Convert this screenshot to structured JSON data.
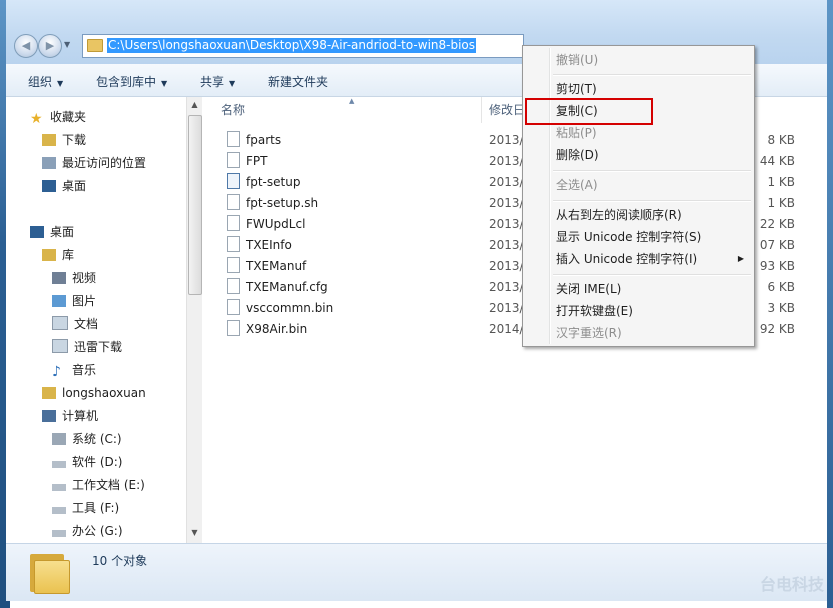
{
  "address": {
    "path": "C:\\Users\\longshaoxuan\\Desktop\\X98-Air-andriod-to-win8-bios"
  },
  "toolbar": {
    "organize": "组织",
    "include_in_library": "包含到库中",
    "share": "共享",
    "new_folder": "新建文件夹"
  },
  "nav": {
    "favorites": "收藏夹",
    "fav_items": [
      "下载",
      "最近访问的位置",
      "桌面"
    ],
    "desktop": "桌面",
    "library": "库",
    "lib_items": [
      "视频",
      "图片",
      "文档",
      "迅雷下载",
      "音乐"
    ],
    "user": "longshaoxuan",
    "computer": "计算机",
    "drives": [
      "系统 (C:)",
      "软件 (D:)",
      "工作文档 (E:)",
      "工具 (F:)",
      "办公 (G:)"
    ]
  },
  "columns": {
    "name": "名称",
    "date": "修改日"
  },
  "files": [
    {
      "name": "fparts",
      "date": "2013/9",
      "size": "8 KB"
    },
    {
      "name": "FPT",
      "date": "2013/9",
      "size": "44 KB"
    },
    {
      "name": "fpt-setup",
      "date": "2013/9",
      "size": "1 KB"
    },
    {
      "name": "fpt-setup.sh",
      "date": "2013/9",
      "size": "1 KB"
    },
    {
      "name": "FWUpdLcl",
      "date": "2013/9",
      "size": "22 KB"
    },
    {
      "name": "TXEInfo",
      "date": "2013/9",
      "size": "07 KB"
    },
    {
      "name": "TXEManuf",
      "date": "2013/9",
      "size": "93 KB"
    },
    {
      "name": "TXEManuf.cfg",
      "date": "2013/9",
      "size": "6 KB"
    },
    {
      "name": "vsccommn.bin",
      "date": "2013/9",
      "size": "3 KB"
    },
    {
      "name": "X98Air.bin",
      "date": "2014/8",
      "size": "92 KB"
    }
  ],
  "status": {
    "count": "10 个对象"
  },
  "watermark": "台电科技",
  "context_menu": {
    "undo": "撤销(U)",
    "cut": "剪切(T)",
    "copy": "复制(C)",
    "paste": "粘贴(P)",
    "delete": "删除(D)",
    "select_all": "全选(A)",
    "rtl": "从右到左的阅读顺序(R)",
    "show_unicode": "显示 Unicode 控制字符(S)",
    "insert_unicode": "插入 Unicode 控制字符(I)",
    "close_ime": "关闭 IME(L)",
    "soft_keyboard": "打开软键盘(E)",
    "reconvert": "汉字重选(R)"
  }
}
